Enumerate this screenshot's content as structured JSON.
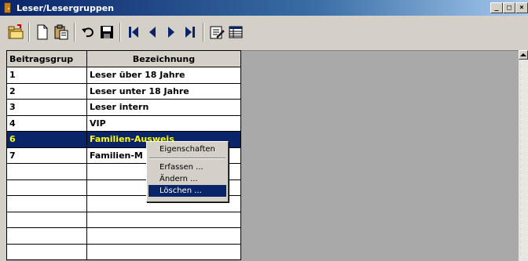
{
  "window": {
    "title": "Leser/Lesergruppen",
    "buttons": [
      {
        "name": "minimize",
        "glyph": "_"
      },
      {
        "name": "maximize",
        "glyph": "□"
      },
      {
        "name": "close",
        "glyph": "×"
      }
    ]
  },
  "toolbar": {
    "icons": [
      "open-folder-icon",
      "new-document-icon",
      "paste-icon",
      "undo-icon",
      "save-icon",
      "first-record-icon",
      "previous-record-icon",
      "next-record-icon",
      "last-record-icon",
      "properties-icon",
      "table-view-icon"
    ]
  },
  "grid": {
    "columns": [
      "Beitragsgrup",
      "Bezeichnung"
    ],
    "rows": [
      {
        "id": "1",
        "name": "Leser über 18 Jahre"
      },
      {
        "id": "2",
        "name": "Leser unter 18 Jahre"
      },
      {
        "id": "3",
        "name": "Leser intern"
      },
      {
        "id": "4",
        "name": "VIP"
      },
      {
        "id": "6",
        "name": "Familien-Ausweis"
      },
      {
        "id": "7",
        "name": "Familien-M"
      },
      {
        "id": "",
        "name": ""
      },
      {
        "id": "",
        "name": ""
      },
      {
        "id": "",
        "name": ""
      },
      {
        "id": "",
        "name": ""
      },
      {
        "id": "",
        "name": ""
      },
      {
        "id": "",
        "name": ""
      }
    ],
    "selected_row": 4
  },
  "context_menu": {
    "properties": "Eigenschaften",
    "add": "Erfassen ...",
    "edit": "Ändern ...",
    "delete": "Löschen ..."
  },
  "colors": {
    "selection_bg": "#0a246a",
    "selection_text": "#ffff00",
    "titlebar": "#0a246a"
  }
}
